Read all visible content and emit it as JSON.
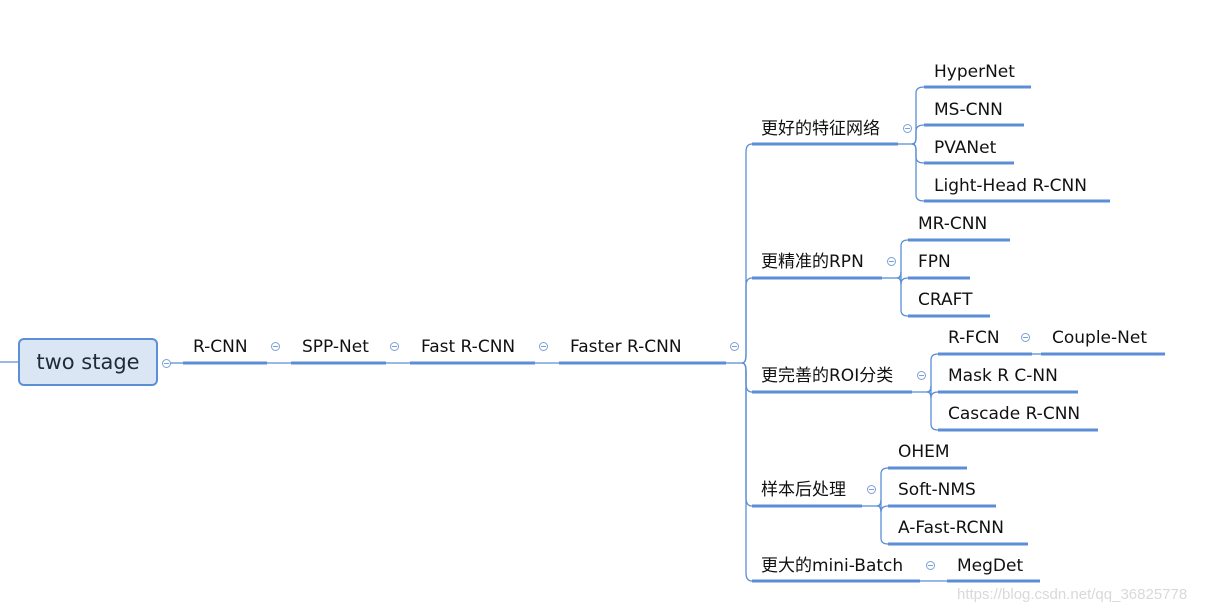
{
  "mindmap": {
    "root": {
      "label": "two stage"
    },
    "chain": [
      "R-CNN",
      "SPP-Net",
      "Fast R-CNN",
      "Faster R-CNN"
    ],
    "branches": [
      {
        "label": "更好的特征网络",
        "children": [
          "HyperNet",
          "MS-CNN",
          "PVANet",
          "Light-Head R-CNN"
        ]
      },
      {
        "label": "更精准的RPN",
        "children": [
          "MR-CNN",
          "FPN",
          "CRAFT"
        ]
      },
      {
        "label": "更完善的ROI分类",
        "children": [
          "R-FCN",
          "Mask R C-NN",
          "Cascade R-CNN"
        ],
        "sub": {
          "R-FCN": "Couple-Net"
        }
      },
      {
        "label": "样本后处理",
        "children": [
          "OHEM",
          "Soft-NMS",
          "A-Fast-RCNN"
        ]
      },
      {
        "label": "更大的mini-Batch",
        "children": [
          "MegDet"
        ]
      }
    ]
  },
  "colors": {
    "line": "#5b8ed6",
    "root_fill": "#dbe6f5",
    "root_border": "#5b8ed6"
  },
  "watermark": "https://blog.csdn.net/qq_36825778"
}
